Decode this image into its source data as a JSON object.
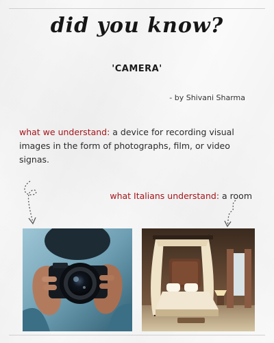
{
  "title": "did you know?",
  "subject": "'CAMERA'",
  "byline": "- by Shivani Sharma",
  "english": {
    "label": "what we understand:",
    "text": " a device for recording visual images in the form of photographs, film, or video signas."
  },
  "italian": {
    "label": "what Italians understand:",
    "text": " a room"
  },
  "colors": {
    "accent": "#a3151a",
    "text": "#1a1a1a"
  },
  "images": {
    "left": "photographer-holding-camera-photo",
    "right": "canopy-bedroom-photo"
  }
}
